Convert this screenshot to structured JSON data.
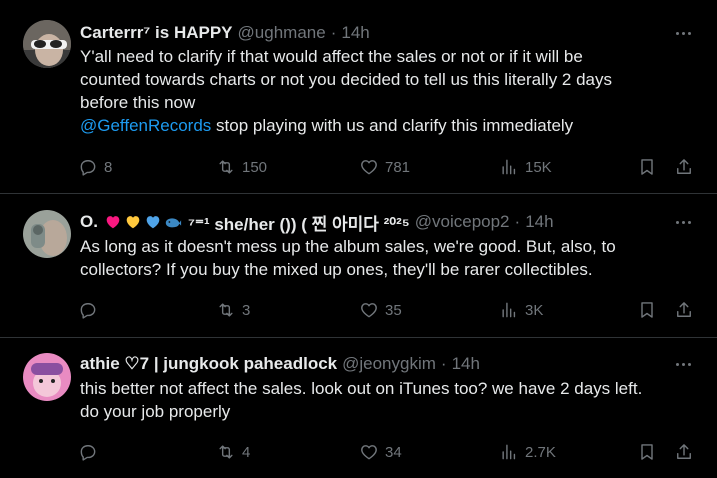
{
  "tweets": [
    {
      "name": "Carterrr⁷ is HAPPY",
      "handle": "@ughmane",
      "separator": "·",
      "time": "14h",
      "text_lines": [
        "Y'all need to clarify if that would affect the sales or not or if it will be",
        "counted towards charts or not you decided to tell us this literally 2 days",
        "before this now"
      ],
      "mention": "@GeffenRecords",
      "text_after_mention": " stop playing with us and clarify this immediately",
      "replies": "8",
      "reposts": "150",
      "likes": "781",
      "views": "15K"
    },
    {
      "name_prefix": "O.",
      "name_suffix": "⁷⁼¹ she/her ()) ( 찐 아미다 ²⁰²⁵",
      "handle": "@voicepop2",
      "separator": "·",
      "time": "14h",
      "text_lines": [
        "As long as it doesn't mess up the album sales, we're good. But, also, to",
        "collectors? If you buy the mixed up ones, they'll be rarer collectibles."
      ],
      "replies": "",
      "reposts": "3",
      "likes": "35",
      "views": "3K"
    },
    {
      "name": "athie ♡7 | jungkook paheadlock",
      "handle": "@jeonygkim",
      "separator": "·",
      "time": "14h",
      "text_lines": [
        "this better not affect the sales. look out on iTunes too? we have 2 days left.",
        "do your job properly"
      ],
      "replies": "",
      "reposts": "4",
      "likes": "34",
      "views": "2.7K"
    }
  ],
  "colors": {
    "background": "#000000",
    "text": "#e7e9ea",
    "secondary": "#71767b",
    "link": "#1d9bf0",
    "divider": "#2f3336"
  },
  "icons": [
    "more-icon",
    "reply-icon",
    "repost-icon",
    "like-icon",
    "views-icon",
    "bookmark-icon",
    "share-icon"
  ]
}
